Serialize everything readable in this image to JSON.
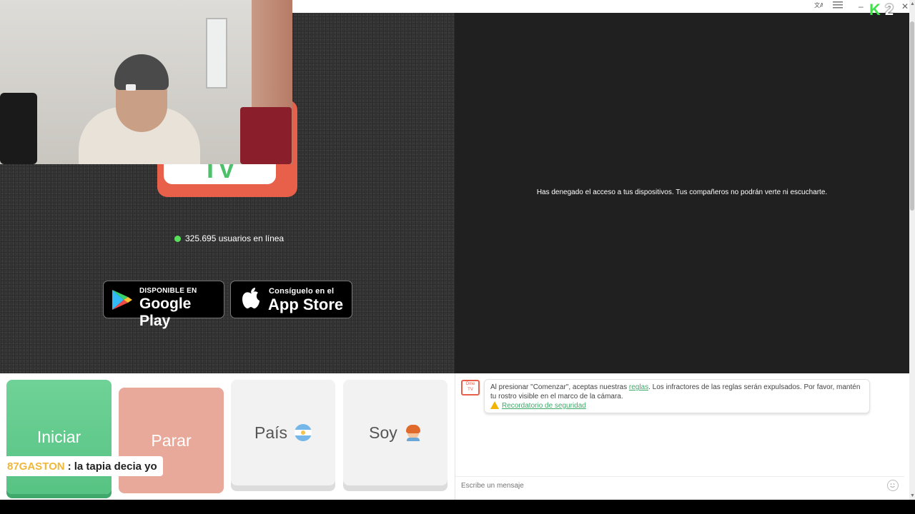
{
  "topbar": {
    "translate_icon": "translate-icon",
    "menu_icon": "menu-icon",
    "minimize": "–",
    "close": "✕"
  },
  "watermark": {
    "k": "K",
    "num": "2"
  },
  "main": {
    "online_text": "325.695 usuarios en línea",
    "google_play": {
      "small": "DISPONIBLE EN",
      "big": "Google Play"
    },
    "app_store": {
      "small": "Consíguelo en el",
      "big": "App Store"
    },
    "tv_text": "TV"
  },
  "partner": {
    "denied_message": "Has denegado el acceso a tus dispositivos. Tus compañeros no podrán verte ni escucharte."
  },
  "controls": {
    "start": "Iniciar",
    "stop": "Parar",
    "country": "País",
    "soy": "Soy"
  },
  "overlay_comment": {
    "user": "87GASTON",
    "text": ": la tapia decia yo"
  },
  "chat": {
    "logo_text": "Ome TV",
    "notice_before": "Al presionar \"Comenzar\", aceptas nuestras ",
    "notice_link": "reglas",
    "notice_after": ". Los infractores de las reglas serán expulsados. Por favor, mantén tu rostro visible en el marco de la cámara.",
    "safety_link": "Recordatorio de seguridad",
    "input_placeholder": "Escribe un mensaje"
  },
  "colors": {
    "start": "#57c383",
    "stop": "#e9a99a",
    "online_dot": "#59e05a",
    "logo": "#e8604a"
  }
}
